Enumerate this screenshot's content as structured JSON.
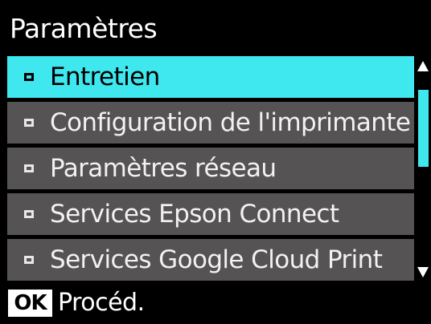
{
  "header": {
    "title": "Paramètres"
  },
  "menu": {
    "items": [
      {
        "label": "Entretien",
        "selected": true
      },
      {
        "label": "Configuration de l'imprimante",
        "selected": false
      },
      {
        "label": "Paramètres réseau",
        "selected": false
      },
      {
        "label": "Services Epson Connect",
        "selected": false
      },
      {
        "label": "Services Google Cloud Print",
        "selected": false
      }
    ],
    "bullet_icon": "square-bullet-icon"
  },
  "scrollbar": {
    "up_icon": "scroll-up-arrow-icon",
    "down_icon": "scroll-down-arrow-icon",
    "position": 0
  },
  "footer": {
    "ok_label": "OK",
    "action_label": "Procéd."
  },
  "colors": {
    "background": "#000000",
    "item_background": "#555353",
    "selected_background": "#3fe7ee",
    "text": "#f2f2f2",
    "selected_text": "#000000"
  }
}
